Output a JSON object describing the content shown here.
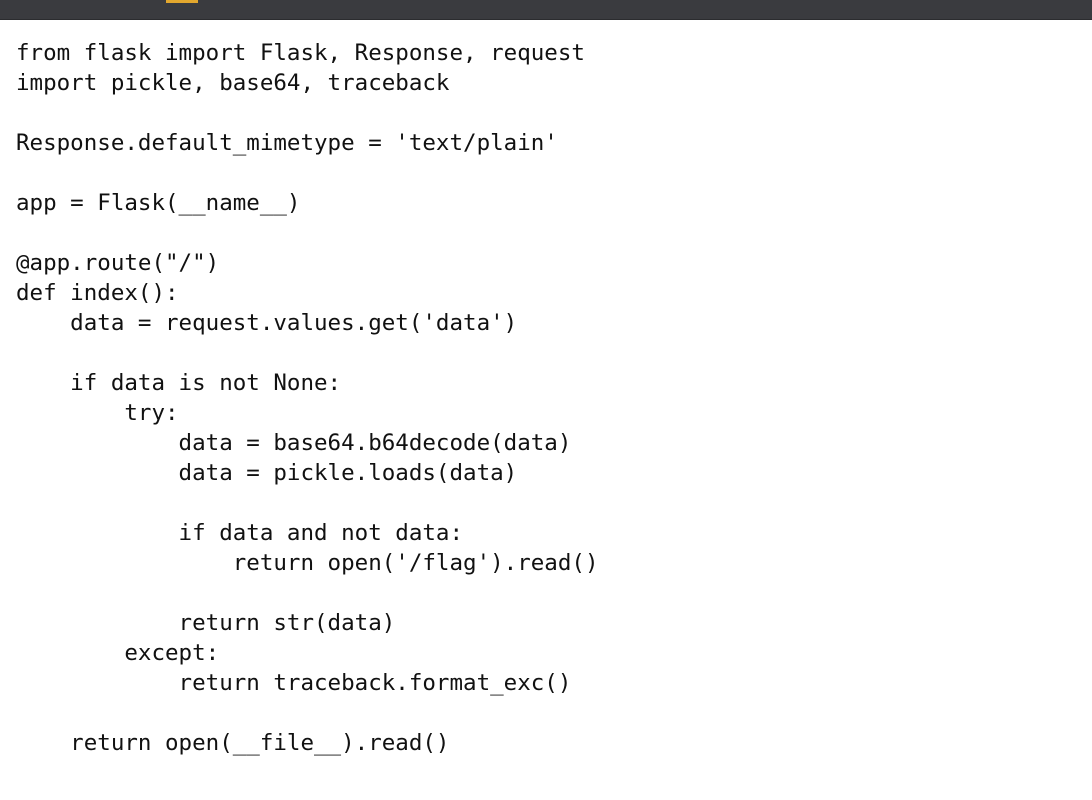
{
  "window": {
    "accent_color": "#e2a72e",
    "bar_color": "#3a3b3f"
  },
  "code": {
    "lines": [
      "from flask import Flask, Response, request",
      "import pickle, base64, traceback",
      "",
      "Response.default_mimetype = 'text/plain'",
      "",
      "app = Flask(__name__)",
      "",
      "@app.route(\"/\")",
      "def index():",
      "    data = request.values.get('data')",
      "",
      "    if data is not None:",
      "        try:",
      "            data = base64.b64decode(data)",
      "            data = pickle.loads(data)",
      "",
      "            if data and not data:",
      "                return open('/flag').read()",
      "",
      "            return str(data)",
      "        except:",
      "            return traceback.format_exc()",
      "",
      "    return open(__file__).read()"
    ]
  }
}
